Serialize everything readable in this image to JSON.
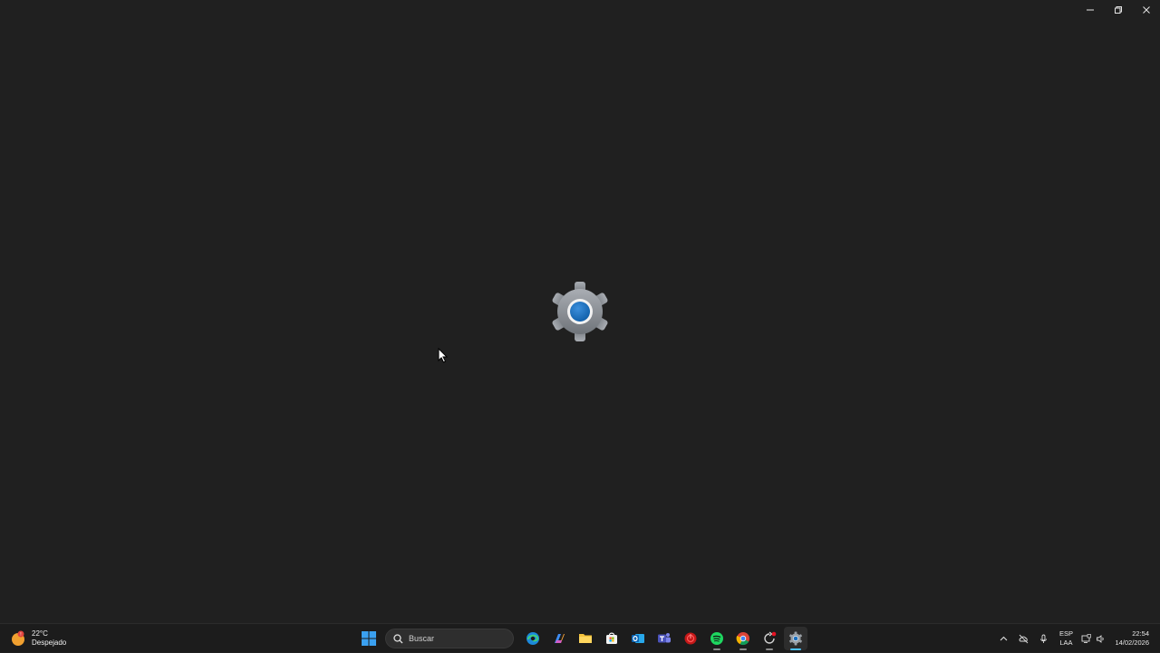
{
  "window": {
    "caption": {
      "minimize": "minimize-icon",
      "maximize": "restore-icon",
      "close": "close-icon"
    },
    "splash_icon": "settings-gear-icon"
  },
  "taskbar": {
    "weather": {
      "temperature": "22°C",
      "condition": "Despejado",
      "icon": "weather-sun-icon"
    },
    "search": {
      "label": "Buscar"
    },
    "apps": [
      {
        "name": "start-button",
        "icon": "windows-logo-icon"
      },
      {
        "name": "edge",
        "icon": "edge-icon"
      },
      {
        "name": "copilot",
        "icon": "copilot-icon"
      },
      {
        "name": "file-explorer",
        "icon": "folder-icon"
      },
      {
        "name": "microsoft-store",
        "icon": "store-icon"
      },
      {
        "name": "outlook",
        "icon": "outlook-icon"
      },
      {
        "name": "teams",
        "icon": "teams-icon"
      },
      {
        "name": "red-app",
        "icon": "red-circle-app-icon"
      },
      {
        "name": "spotify",
        "icon": "spotify-icon"
      },
      {
        "name": "chrome",
        "icon": "chrome-icon"
      },
      {
        "name": "sync-app",
        "icon": "sync-app-icon"
      },
      {
        "name": "settings",
        "icon": "settings-icon"
      }
    ],
    "tray": {
      "language_line1": "ESP",
      "language_line2": "LAA",
      "time": "22:54",
      "date": "14/02/2026"
    }
  },
  "colors": {
    "background": "#202020",
    "taskbar": "#1c1c1c",
    "accent": "#4cc2ff"
  }
}
